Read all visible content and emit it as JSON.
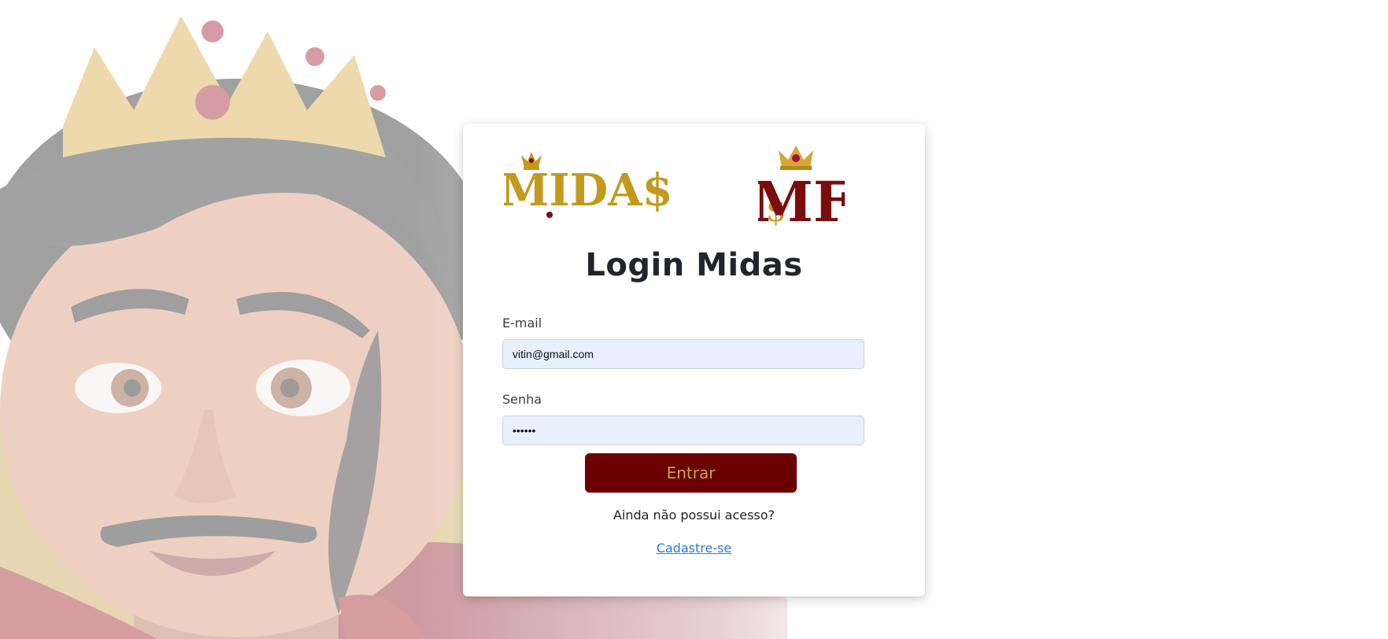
{
  "login_card": {
    "title": "Login Midas",
    "logo_text": "MIDA$",
    "monogram_text": "MF",
    "email": {
      "label": "E-mail",
      "value": "vitin@gmail.com"
    },
    "password": {
      "label": "Senha",
      "value": "••••••"
    },
    "submit_label": "Entrar",
    "no_access_text": "Ainda não possui acesso?",
    "signup_link": "Cadastre-se"
  },
  "colors": {
    "button_bg": "#6b0000",
    "button_text": "#c9a34a",
    "link": "#2a7ad8",
    "input_bg": "#e8f0fe",
    "gold": "#c39a1d",
    "crimson": "#7a0c0c"
  },
  "icons": {
    "background": "king-illustration",
    "logo": "midas-logo",
    "monogram": "mf-crown-logo"
  }
}
